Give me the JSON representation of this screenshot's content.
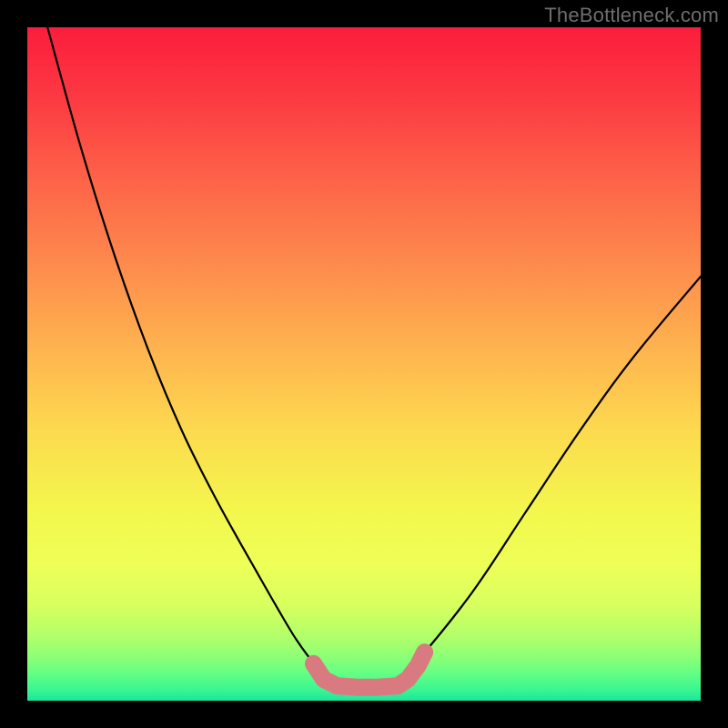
{
  "watermark": "TheBottleneck.com",
  "chart_data": {
    "type": "line",
    "title": "",
    "xlabel": "",
    "ylabel": "",
    "xlim": [
      0,
      100
    ],
    "ylim": [
      0,
      100
    ],
    "grid": false,
    "legend": false,
    "series": [
      {
        "name": "bottleneck-curve",
        "color": "#000000",
        "x": [
          3,
          8,
          13,
          18,
          23,
          28,
          33,
          37,
          40,
          43,
          46,
          50,
          54,
          58,
          66,
          74,
          82,
          90,
          100
        ],
        "y": [
          100,
          82,
          66,
          52,
          40,
          30,
          21,
          14,
          9,
          5,
          2,
          2,
          2,
          6,
          16,
          28,
          40,
          51,
          63
        ]
      }
    ],
    "highlight": {
      "name": "optimal-range",
      "color": "#d97a80",
      "x": [
        42.5,
        44,
        46,
        49,
        52,
        55,
        56.5,
        58,
        59
      ],
      "y": [
        5.5,
        3.2,
        2.2,
        2,
        2,
        2.2,
        3.2,
        5.2,
        7.2
      ]
    },
    "background_gradient": {
      "stops": [
        {
          "pos": 0.0,
          "color": "#fb1d3c"
        },
        {
          "pos": 0.1,
          "color": "#fc3841"
        },
        {
          "pos": 0.22,
          "color": "#fd6148"
        },
        {
          "pos": 0.35,
          "color": "#fd8a4d"
        },
        {
          "pos": 0.48,
          "color": "#feb44f"
        },
        {
          "pos": 0.6,
          "color": "#fdda4f"
        },
        {
          "pos": 0.72,
          "color": "#f3f74d"
        },
        {
          "pos": 0.8,
          "color": "#eeff57"
        },
        {
          "pos": 0.86,
          "color": "#d6ff5f"
        },
        {
          "pos": 0.905,
          "color": "#b1ff6a"
        },
        {
          "pos": 0.935,
          "color": "#8cff76"
        },
        {
          "pos": 0.96,
          "color": "#62ff84"
        },
        {
          "pos": 0.985,
          "color": "#38f592"
        },
        {
          "pos": 1.0,
          "color": "#1de49d"
        }
      ]
    }
  }
}
